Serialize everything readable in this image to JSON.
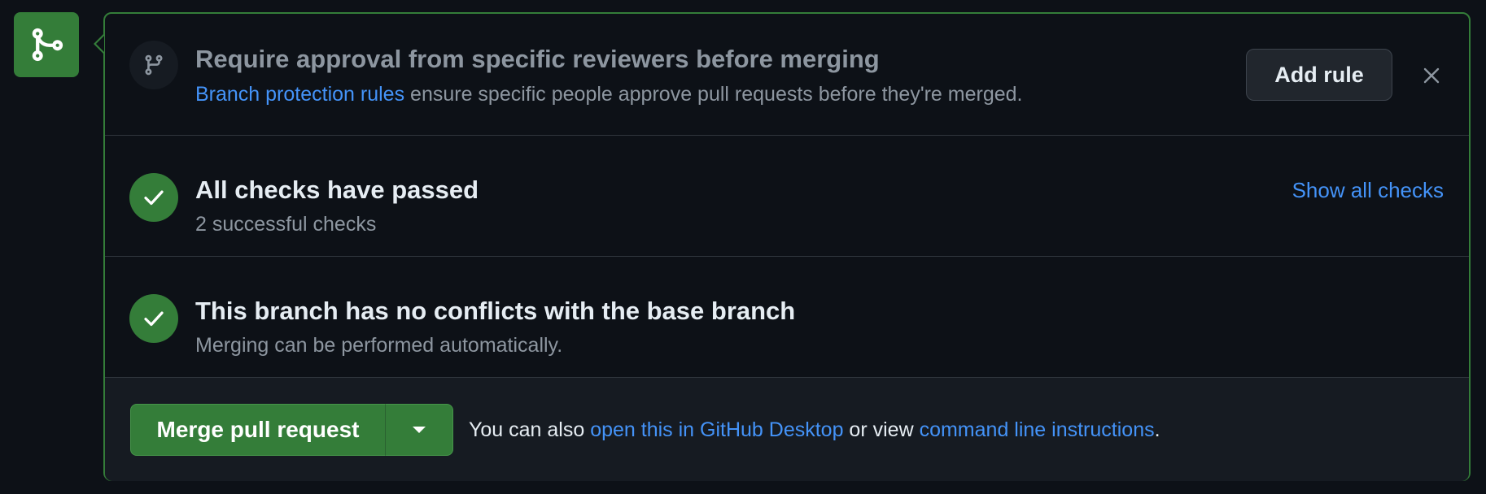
{
  "icons": {
    "merge_badge": "git-merge-icon",
    "branch": "git-branch-icon",
    "check": "check-icon",
    "close": "close-icon",
    "caret": "triangle-down-icon"
  },
  "colors": {
    "accent_green": "#347d39",
    "link_blue": "#4493f8",
    "muted_text": "#8d96a0",
    "background": "#0d1117"
  },
  "protection": {
    "title": "Require approval from specific reviewers before merging",
    "link_text": "Branch protection rules",
    "rest_text": " ensure specific people approve pull requests before they're merged.",
    "add_rule_label": "Add rule"
  },
  "checks": {
    "title": "All checks have passed",
    "subtitle": "2 successful checks",
    "show_all_label": "Show all checks"
  },
  "conflicts": {
    "title": "This branch has no conflicts with the base branch",
    "subtitle": "Merging can be performed automatically."
  },
  "merge": {
    "button_label": "Merge pull request",
    "also_prefix": "You can also ",
    "desktop_link": "open this in GitHub Desktop",
    "or_view": " or view ",
    "cli_link": "command line instructions",
    "suffix": "."
  }
}
